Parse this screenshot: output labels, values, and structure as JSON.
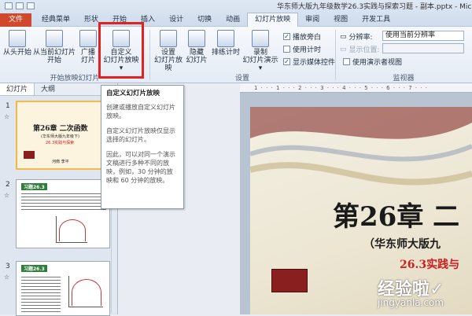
{
  "window": {
    "title": "华东师大版九年级数学26.3实践与探索习题 - 副本.pptx - Microso"
  },
  "tabs": [
    "文件",
    "经典菜单",
    "开始",
    "插入",
    "设计",
    "切换",
    "动画",
    "幻灯片放映",
    "审阅",
    "视图",
    "开发工具"
  ],
  "tab_partial": "形状",
  "ribbon": {
    "from_start": "从头开始",
    "from_current_1": "从当前幻灯片",
    "from_current_2": "开始",
    "broadcast_1": "广播",
    "broadcast_2": "灯片",
    "custom_1": "自定义",
    "custom_2": "幻灯片放映",
    "group_start": "开始放映幻灯片",
    "setup_1": "设置",
    "setup_2": "幻灯片放映",
    "hide_1": "隐藏",
    "hide_2": "幻灯片",
    "rehearse": "排练计时",
    "record_1": "录制",
    "record_2": "幻灯片演示",
    "group_setup": "设置",
    "chk_narration": "播放旁白",
    "chk_timing": "使用计时",
    "chk_media": "显示媒体控件",
    "resolution_label": "分辨率:",
    "resolution_value": "使用当前分辨率",
    "show_on_label": "显示位置:",
    "presenter_view": "使用演示者视图",
    "group_monitor": "监视器"
  },
  "panel": {
    "tab_slides": "幻灯片",
    "tab_outline": "大纲",
    "thumb1": {
      "num": "1",
      "title": "第26章  二次函数",
      "sub": "(华东师大版九年级下)",
      "sub2": "26.3实践与探索",
      "author": "河南      李平"
    },
    "thumb2": {
      "num": "2",
      "heading": "习题26.3"
    },
    "thumb3": {
      "num": "3",
      "heading": "习题26.3"
    }
  },
  "tooltip": {
    "title": "自定义幻灯片放映",
    "p1": "创建或播放自定义幻灯片放映。",
    "p2": "自定义幻灯片放映仅显示选择的幻灯片。",
    "p3": "因此，可以对同一个演示文稿进行多种不同的放映，例如，30 分钟的放映和 60 分钟的放映。"
  },
  "ruler_text": "1 · · · 1 · · · 2 · · · 3 · · · 4 · · · 5 · · · 6 · · · 7 · · ·",
  "slide": {
    "title": "第26章  二",
    "subtitle": "（华东师大版九",
    "subtitle2": "26.3实践与"
  },
  "watermark": {
    "text": "经验啦✓",
    "url": "jingyanla.com"
  },
  "colors": {
    "file_tab": "#d0492d",
    "highlight": "#e12222",
    "accent_red": "#cc1f1f"
  }
}
